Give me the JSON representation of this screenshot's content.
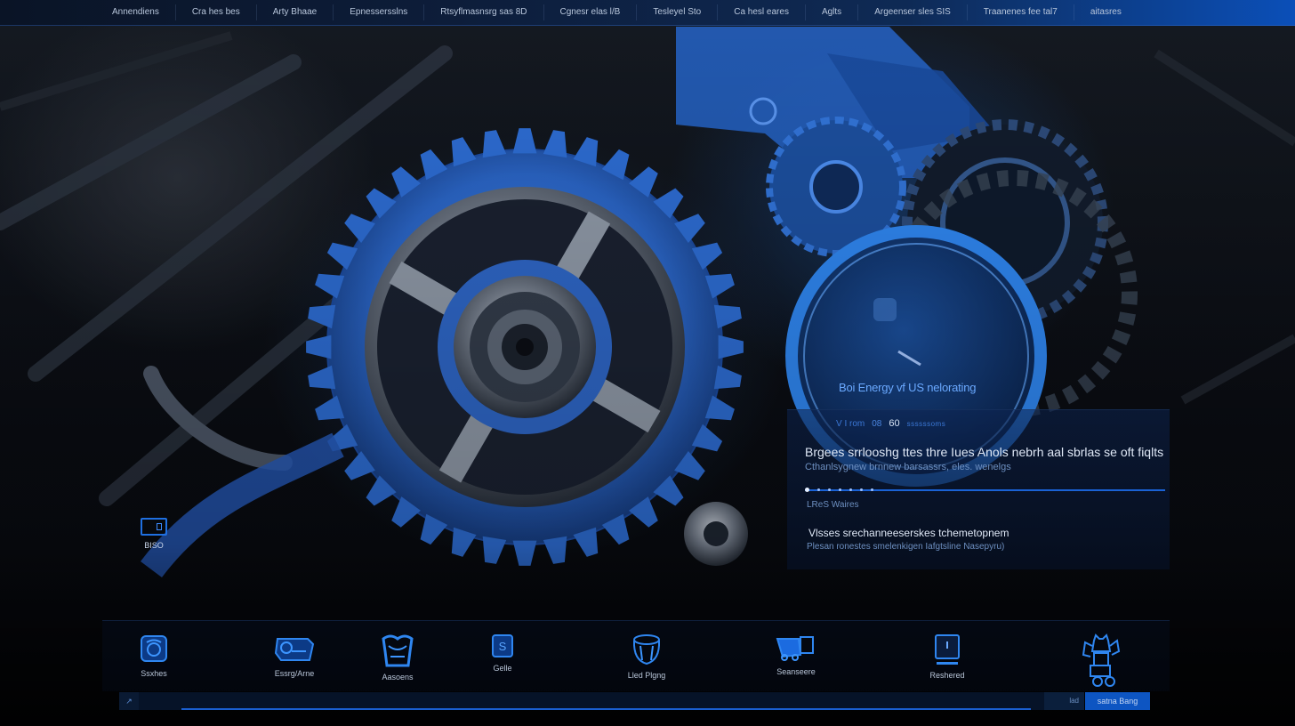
{
  "topnav": {
    "items": [
      {
        "label": "Annendiens"
      },
      {
        "label": "Cra hes bes"
      },
      {
        "label": "Arty Bhaae"
      },
      {
        "label": "Epnessersslns"
      },
      {
        "label": "Rtsyflmasnsrg sas 8D"
      },
      {
        "label": "Cgnesr elas l/B"
      },
      {
        "label": "Tesleyel Sto"
      },
      {
        "label": "Ca hesl eares"
      },
      {
        "label": "Aglts"
      },
      {
        "label": "Argeenser sles SIS"
      },
      {
        "label": "Traanenes fee tal7"
      },
      {
        "label": "aitasres"
      }
    ]
  },
  "hero": {
    "gauge_label": "Boi Energy vf US nelorating",
    "meta": [
      "V I rom",
      "08",
      "60",
      "ssssssoms"
    ]
  },
  "info": {
    "title": "Brgees srrlooshg ttes thre  Iues Anols nebrh aal sbrlas se oft fiqlts",
    "subtitle": "Cthanlsygnew brnnew barsassrs, eles. wenelgs",
    "section_label": "LReS Waires",
    "section_title": "Vlsses srechanneeserskes tchemetopnem",
    "section_sub": "Plesan ronestes smelenkigen Iafgtsline Nasepyru)"
  },
  "side_widget": {
    "label": "BISO"
  },
  "dock": {
    "items": [
      {
        "label": "Ssxhes",
        "icon": "engine-badge-icon"
      },
      {
        "label": "Essrg/Arne",
        "icon": "machine-block-icon"
      },
      {
        "label": "Aasoens",
        "icon": "tooth-arch-icon"
      },
      {
        "label": "Gelle",
        "icon": "code-badge-icon"
      },
      {
        "label": "Lled Plgng",
        "icon": "drum-icon"
      },
      {
        "label": "Seanseere",
        "icon": "truck-icon"
      },
      {
        "label": "Reshered",
        "icon": "tablet-icon"
      },
      {
        "label": "",
        "icon": "robot-icon"
      }
    ]
  },
  "cmdbar": {
    "icon": "link-icon",
    "placeholder": "",
    "hint": "lad",
    "button_label": "satna Bang"
  },
  "colors": {
    "accent": "#1a62d6",
    "nav_bg_end": "#0b4fb8",
    "gear_blue": "#2a6fd6"
  }
}
